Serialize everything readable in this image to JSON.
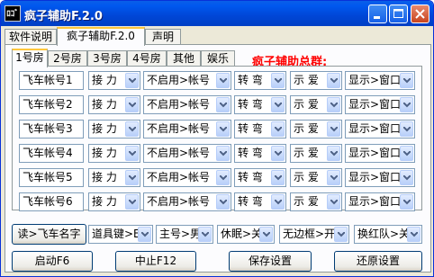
{
  "window": {
    "title": "疯子辅助F.2.0",
    "icon_name": "app-icon",
    "icon_text": "ﾛｺﾞ"
  },
  "tabs": [
    "软件说明",
    "疯子辅助F.2.0",
    "声明"
  ],
  "active_tab": 1,
  "sub_tabs": [
    "1号房",
    "2号房",
    "3号房",
    "4号房",
    "其他",
    "娱乐"
  ],
  "active_sub_tab": 0,
  "group_title": "疯子辅助总群:",
  "accounts": [
    {
      "name": "飞车帐号1",
      "action": "接 力",
      "mode": "不启用>帐号",
      "move": "转 弯",
      "show": "示 爱",
      "display": "显示>窗口"
    },
    {
      "name": "飞车帐号2",
      "action": "接 力",
      "mode": "不启用>帐号",
      "move": "转 弯",
      "show": "示 爱",
      "display": "显示>窗口"
    },
    {
      "name": "飞车帐号3",
      "action": "接 力",
      "mode": "不启用>帐号",
      "move": "转 弯",
      "show": "示 爱",
      "display": "显示>窗口"
    },
    {
      "name": "飞车帐号4",
      "action": "接 力",
      "mode": "不启用>帐号",
      "move": "转 弯",
      "show": "示 爱",
      "display": "显示>窗口"
    },
    {
      "name": "飞车帐号5",
      "action": "接 力",
      "mode": "不启用>帐号",
      "move": "转 弯",
      "show": "示 爱",
      "display": "显示>窗口"
    },
    {
      "name": "飞车帐号6",
      "action": "接 力",
      "mode": "不启用>帐号",
      "move": "转 弯",
      "show": "示 爱",
      "display": "显示>窗口"
    }
  ],
  "options_bar": {
    "read_button": "读>飞车名字",
    "items_key": "道具键>E",
    "main_account": "主号>男",
    "sleep": "休眠>关",
    "borderless": "无边框>开",
    "switch_team": "换红队>关"
  },
  "buttons": {
    "start": "启动F6",
    "stop": "中止F12",
    "save": "保存设置",
    "restore": "还原设置"
  }
}
